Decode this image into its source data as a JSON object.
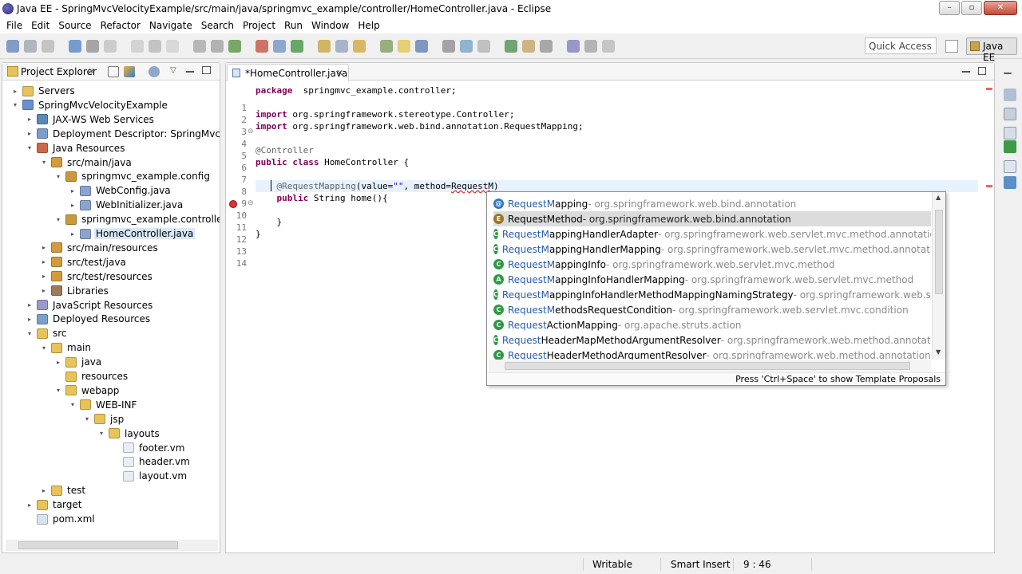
{
  "window": {
    "title": "Java EE - SpringMvcVelocityExample/src/main/java/springmvc_example/controller/HomeController.java - Eclipse",
    "buttons": {
      "minimize": "–",
      "maximize": "▫",
      "close": "✕"
    }
  },
  "menu": [
    "File",
    "Edit",
    "Source",
    "Refactor",
    "Navigate",
    "Search",
    "Project",
    "Run",
    "Window",
    "Help"
  ],
  "toolbar": {
    "quick_access": "Quick Access",
    "perspective": "Java EE"
  },
  "explorer": {
    "tab_label": "Project Explorer",
    "tab_close": "✕",
    "items": [
      {
        "label": "Servers",
        "depth": 0,
        "twisty": "▸",
        "icon": "folder-icon"
      },
      {
        "label": "SpringMvcVelocityExample",
        "depth": 0,
        "twisty": "▾",
        "icon": "project-icon"
      },
      {
        "label": "JAX-WS Web Services",
        "depth": 1,
        "twisty": "▸",
        "icon": "webservice-icon"
      },
      {
        "label": "Deployment Descriptor: SpringMvcVelocityExample",
        "depth": 1,
        "twisty": "▸",
        "icon": "descriptor-icon"
      },
      {
        "label": "Java Resources",
        "depth": 1,
        "twisty": "▾",
        "icon": "java-resources-icon"
      },
      {
        "label": "src/main/java",
        "depth": 2,
        "twisty": "▾",
        "icon": "source-folder-icon"
      },
      {
        "label": "springmvc_example.config",
        "depth": 3,
        "twisty": "▾",
        "icon": "package-icon"
      },
      {
        "label": "WebConfig.java",
        "depth": 4,
        "twisty": "▸",
        "icon": "java-file-icon"
      },
      {
        "label": "WebInitializer.java",
        "depth": 4,
        "twisty": "▸",
        "icon": "java-file-icon"
      },
      {
        "label": "springmvc_example.controller",
        "depth": 3,
        "twisty": "▾",
        "icon": "package-icon"
      },
      {
        "label": "HomeController.java",
        "depth": 4,
        "twisty": "▸",
        "icon": "java-file-icon",
        "selected": true
      },
      {
        "label": "src/main/resources",
        "depth": 2,
        "twisty": "▸",
        "icon": "source-folder-icon"
      },
      {
        "label": "src/test/java",
        "depth": 2,
        "twisty": "▸",
        "icon": "source-folder-icon"
      },
      {
        "label": "src/test/resources",
        "depth": 2,
        "twisty": "▸",
        "icon": "source-folder-icon"
      },
      {
        "label": "Libraries",
        "depth": 2,
        "twisty": "▸",
        "icon": "libraries-icon"
      },
      {
        "label": "JavaScript Resources",
        "depth": 1,
        "twisty": "▸",
        "icon": "js-resources-icon"
      },
      {
        "label": "Deployed Resources",
        "depth": 1,
        "twisty": "▸",
        "icon": "deployed-resources-icon"
      },
      {
        "label": "src",
        "depth": 1,
        "twisty": "▾",
        "icon": "folder-icon"
      },
      {
        "label": "main",
        "depth": 2,
        "twisty": "▾",
        "icon": "folder-icon"
      },
      {
        "label": "java",
        "depth": 3,
        "twisty": "▸",
        "icon": "folder-icon"
      },
      {
        "label": "resources",
        "depth": 3,
        "twisty": "",
        "icon": "folder-icon"
      },
      {
        "label": "webapp",
        "depth": 3,
        "twisty": "▾",
        "icon": "folder-icon"
      },
      {
        "label": "WEB-INF",
        "depth": 4,
        "twisty": "▾",
        "icon": "folder-icon"
      },
      {
        "label": "jsp",
        "depth": 5,
        "twisty": "▾",
        "icon": "folder-icon"
      },
      {
        "label": "layouts",
        "depth": 6,
        "twisty": "▾",
        "icon": "folder-icon"
      },
      {
        "label": "footer.vm",
        "depth": 7,
        "twisty": "",
        "icon": "file-icon"
      },
      {
        "label": "header.vm",
        "depth": 7,
        "twisty": "",
        "icon": "file-icon"
      },
      {
        "label": "layout.vm",
        "depth": 7,
        "twisty": "",
        "icon": "file-icon"
      },
      {
        "label": "test",
        "depth": 2,
        "twisty": "▸",
        "icon": "folder-icon"
      },
      {
        "label": "target",
        "depth": 1,
        "twisty": "▸",
        "icon": "folder-icon"
      },
      {
        "label": "pom.xml",
        "depth": 1,
        "twisty": "",
        "icon": "xml-file-icon"
      }
    ]
  },
  "editor": {
    "tab_label": "*HomeController.java",
    "tab_close": "✕",
    "lines": [
      {
        "n": "1",
        "segs": [
          [
            "kw",
            "package"
          ],
          [
            "",
            "  springmvc_example.controller;"
          ]
        ]
      },
      {
        "n": "2",
        "segs": []
      },
      {
        "n": "3",
        "segs": [
          [
            "kw",
            "import"
          ],
          [
            "",
            " org.springframework.stereotype.Controller;"
          ]
        ],
        "fold": "⊖"
      },
      {
        "n": "4",
        "segs": [
          [
            "kw",
            "import"
          ],
          [
            "",
            " org.springframework.web.bind.annotation.RequestMapping;"
          ]
        ]
      },
      {
        "n": "5",
        "segs": []
      },
      {
        "n": "6",
        "segs": [
          [
            "ann",
            "@Controller"
          ]
        ]
      },
      {
        "n": "7",
        "segs": [
          [
            "kw",
            "public"
          ],
          [
            "",
            " "
          ],
          [
            "kw",
            "class"
          ],
          [
            "",
            " HomeController {"
          ]
        ]
      },
      {
        "n": "8",
        "segs": []
      },
      {
        "n": "9",
        "segs": [
          [
            "",
            "    "
          ],
          [
            "ann",
            "@RequestMapping"
          ],
          [
            "",
            "(value="
          ],
          [
            "str",
            "\"\""
          ],
          [
            "",
            ", method="
          ],
          [
            "err",
            "RequestM"
          ],
          [
            "",
            ")"
          ]
        ],
        "current": true,
        "error": true,
        "fold": "⊖"
      },
      {
        "n": "10",
        "segs": [
          [
            "",
            "    "
          ],
          [
            "kw",
            "public"
          ],
          [
            "",
            " String home(){"
          ]
        ]
      },
      {
        "n": "11",
        "segs": []
      },
      {
        "n": "12",
        "segs": [
          [
            "",
            "    }"
          ]
        ]
      },
      {
        "n": "13",
        "segs": [
          [
            "",
            "}"
          ]
        ]
      },
      {
        "n": "14",
        "segs": []
      }
    ]
  },
  "assist": {
    "proposals": [
      {
        "match": "RequestM",
        "rest": "apping",
        "qual": " - org.springframework.web.bind.annotation",
        "icon": "annotation-icon"
      },
      {
        "match": "RequestM",
        "rest": "ethod",
        "qual": " - org.springframework.web.bind.annotation",
        "icon": "enum-icon",
        "selected": true
      },
      {
        "match": "RequestM",
        "rest": "appingHandlerAdapter",
        "qual": " - org.springframework.web.servlet.mvc.method.annotation",
        "icon": "class-icon"
      },
      {
        "match": "RequestM",
        "rest": "appingHandlerMapping",
        "qual": " - org.springframework.web.servlet.mvc.method.annotation",
        "icon": "class-icon"
      },
      {
        "match": "RequestM",
        "rest": "appingInfo",
        "qual": " - org.springframework.web.servlet.mvc.method",
        "icon": "class-icon"
      },
      {
        "match": "RequestM",
        "rest": "appingInfoHandlerMapping",
        "qual": " - org.springframework.web.servlet.mvc.method",
        "icon": "abstract-class-icon"
      },
      {
        "match": "RequestM",
        "rest": "appingInfoHandlerMethodMappingNamingStrategy",
        "qual": " - org.springframework.web.servlet.mvc.met",
        "icon": "class-icon"
      },
      {
        "match": "RequestM",
        "rest": "ethodsRequestCondition",
        "qual": " - org.springframework.web.servlet.mvc.condition",
        "icon": "class-icon"
      },
      {
        "match": "Request",
        "rest": "ActionMapping",
        "qual": " - org.apache.struts.action",
        "icon": "class-icon"
      },
      {
        "match": "Request",
        "rest": "HeaderMapMethodArgumentResolver",
        "qual": " - org.springframework.web.method.annotation",
        "icon": "class-icon"
      },
      {
        "match": "Request",
        "rest": "HeaderMethodArgumentResolver",
        "qual": " - org.springframework.web.method.annotation",
        "icon": "class-icon"
      }
    ],
    "status": "Press 'Ctrl+Space' to show Template Proposals"
  },
  "statusbar": {
    "writable": "Writable",
    "insert_mode": "Smart Insert",
    "position": "9 : 46"
  },
  "colors": {
    "keyword": "#7f0055",
    "annotation": "#646464",
    "string": "#2a00ff",
    "selection": "#dae8f8",
    "current_line": "#e8f2fe"
  }
}
